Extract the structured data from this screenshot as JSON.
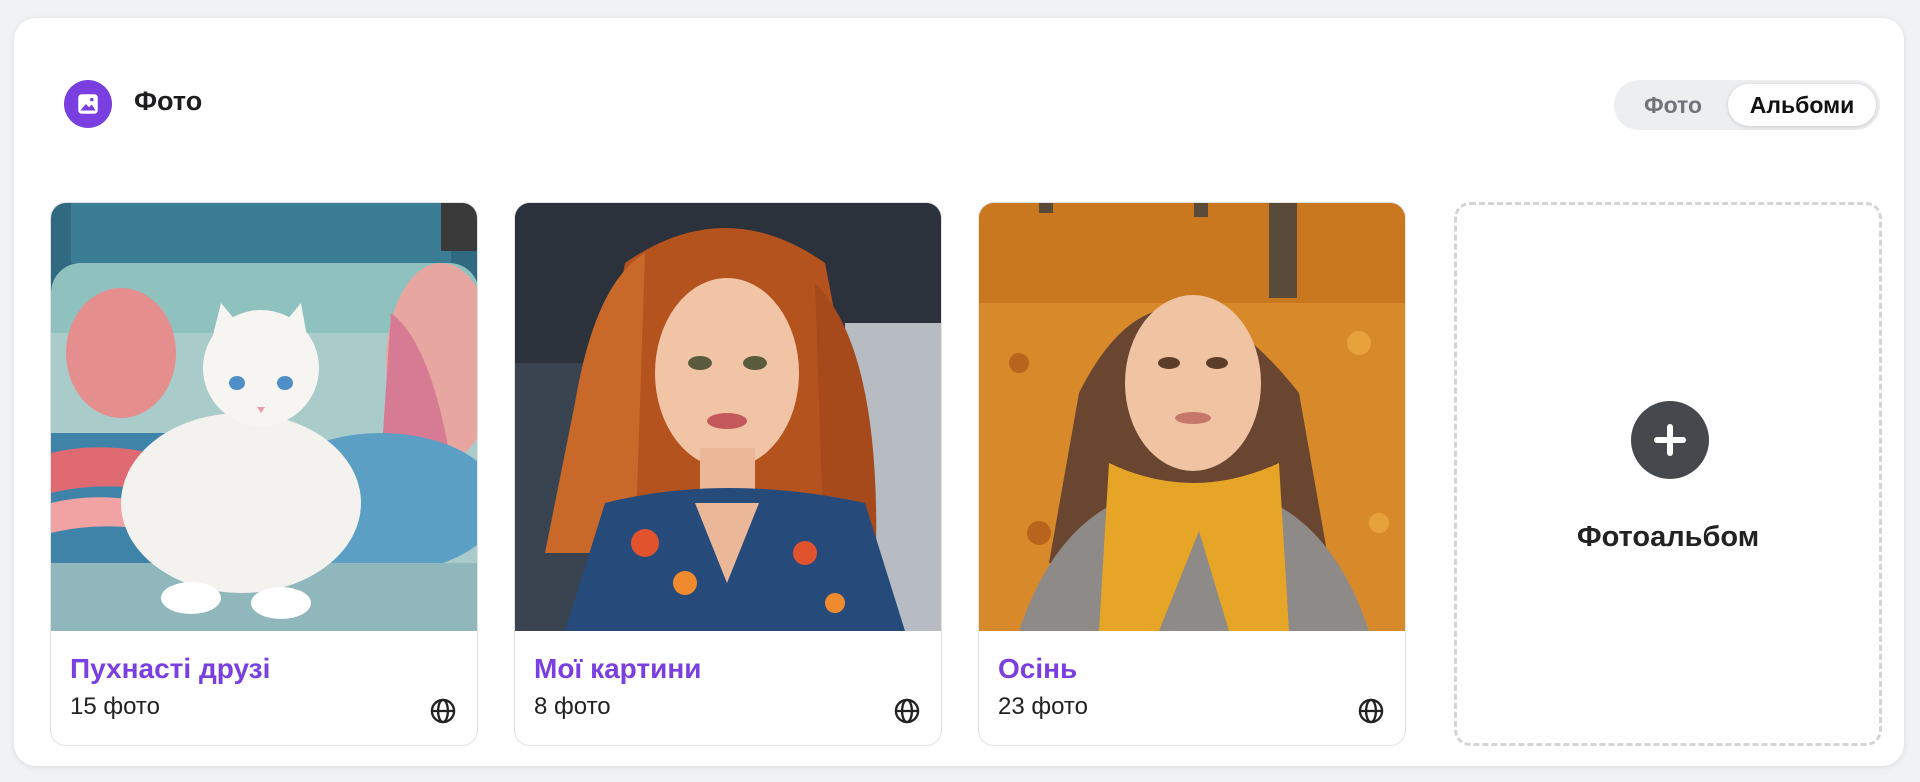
{
  "header": {
    "title": "Фото",
    "icon": "image-icon",
    "accent": "#7a3fe0"
  },
  "view_toggle": {
    "options": [
      "Фото",
      "Альбоми"
    ],
    "selected": "Альбоми"
  },
  "albums": [
    {
      "title": "Пухнасті друзі",
      "count": "15 фото",
      "privacy_icon": "globe-icon",
      "image": "white fluffy cat lying on a blue sofa with pillows"
    },
    {
      "title": "Мої картини",
      "count": "8 фото",
      "privacy_icon": "globe-icon",
      "image": "painted portrait of a woman with long auburn hair"
    },
    {
      "title": "Осінь",
      "count": "23 фото",
      "privacy_icon": "globe-icon",
      "image": "woman in a yellow scarf among autumn leaves"
    }
  ],
  "add_album": {
    "label": "Фотоальбом",
    "icon": "plus-icon"
  }
}
